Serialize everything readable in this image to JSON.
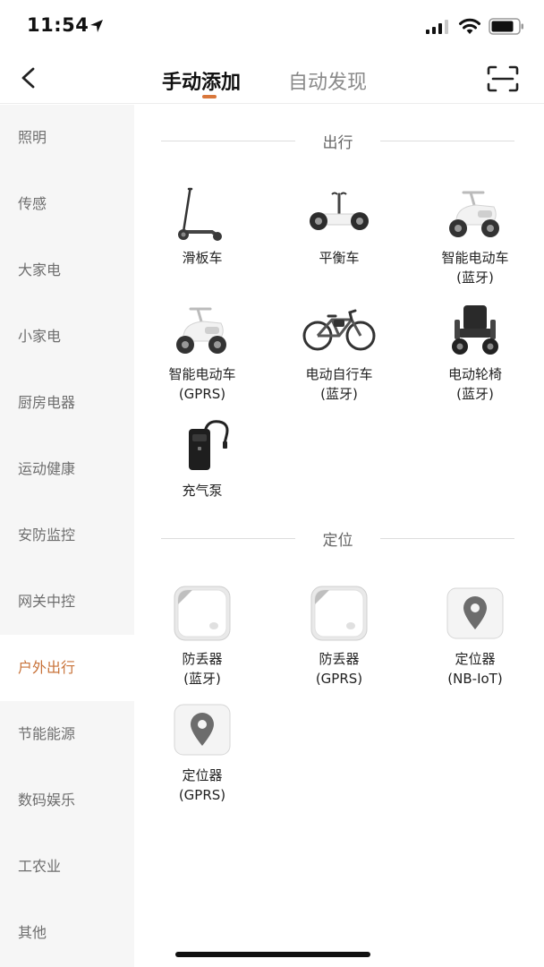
{
  "status_bar": {
    "time": "11:54"
  },
  "nav": {
    "tabs": [
      {
        "label": "手动添加",
        "active": true
      },
      {
        "label": "自动发现",
        "active": false
      }
    ],
    "accent_color": "#d9773b"
  },
  "sidebar": {
    "items": [
      {
        "label": "照明"
      },
      {
        "label": "传感"
      },
      {
        "label": "大家电"
      },
      {
        "label": "小家电"
      },
      {
        "label": "厨房电器"
      },
      {
        "label": "运动健康"
      },
      {
        "label": "安防监控"
      },
      {
        "label": "网关中控"
      },
      {
        "label": "户外出行",
        "active": true
      },
      {
        "label": "节能能源"
      },
      {
        "label": "数码娱乐"
      },
      {
        "label": "工农业"
      },
      {
        "label": "其他"
      }
    ],
    "active_color": "#c8733a"
  },
  "sections": [
    {
      "title": "出行",
      "devices": [
        {
          "name": "滑板车",
          "sub": "",
          "icon": "scooter-icon"
        },
        {
          "name": "平衡车",
          "sub": "",
          "icon": "balance-scooter-icon"
        },
        {
          "name": "智能电动车",
          "sub": "(蓝牙)",
          "icon": "e-moped-icon"
        },
        {
          "name": "智能电动车",
          "sub": "(GPRS)",
          "icon": "e-moped-icon"
        },
        {
          "name": "电动自行车",
          "sub": "(蓝牙)",
          "icon": "e-bike-icon"
        },
        {
          "name": "电动轮椅",
          "sub": "(蓝牙)",
          "icon": "wheelchair-icon"
        },
        {
          "name": "充气泵",
          "sub": "",
          "icon": "air-pump-icon"
        }
      ]
    },
    {
      "title": "定位",
      "devices": [
        {
          "name": "防丢器",
          "sub": "(蓝牙)",
          "icon": "anti-lost-tag-icon"
        },
        {
          "name": "防丢器",
          "sub": "(GPRS)",
          "icon": "anti-lost-tag-icon"
        },
        {
          "name": "定位器",
          "sub": "(NB-IoT)",
          "icon": "locator-icon"
        },
        {
          "name": "定位器",
          "sub": "(GPRS)",
          "icon": "locator-icon"
        }
      ]
    }
  ]
}
